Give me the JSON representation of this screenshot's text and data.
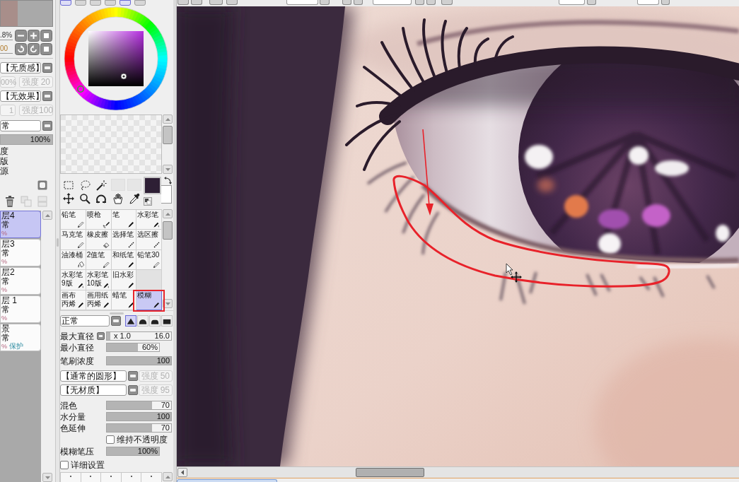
{
  "navigator": {
    "zoom": ".8%",
    "angle": "00"
  },
  "layer_settings": {
    "texture": "【无质感】",
    "texture_scale": {
      "value": "00%",
      "disabled": true
    },
    "texture_strength": {
      "label": "强度",
      "value": "20",
      "disabled": true
    },
    "effect": "【无效果】",
    "effect_width": {
      "value": "1",
      "disabled": true
    },
    "effect_strength": {
      "label": "强度",
      "value": "100",
      "disabled": true
    },
    "blend_mode": "常",
    "opacity": {
      "reading": "100%",
      "level": 1
    },
    "options": [
      "度",
      "版",
      "源"
    ]
  },
  "layers": [
    {
      "name": "层4",
      "mode": "常",
      "opacity": "%",
      "selected": true
    },
    {
      "name": "层3",
      "mode": "常",
      "opacity": "%",
      "selected": false
    },
    {
      "name": "层2",
      "mode": "常",
      "opacity": "%",
      "selected": false
    },
    {
      "name": "层 1",
      "mode": "常",
      "opacity": "%",
      "selected": false
    },
    {
      "name": "景",
      "mode": "常",
      "opacity": "%",
      "badge": "保护",
      "selected": false
    }
  ],
  "color_panel": {
    "modes": [
      {
        "on": true
      },
      {
        "on": false
      },
      {
        "on": false
      },
      {
        "on": false
      },
      {
        "on": true
      },
      {
        "on": false
      }
    ]
  },
  "brushes": [
    {
      "kind": "brush",
      "lines": [
        "铅笔"
      ],
      "selected": false,
      "highlighted": false
    },
    {
      "kind": "brush",
      "lines": [
        "喷枪"
      ],
      "selected": false,
      "highlighted": false
    },
    {
      "kind": "brush",
      "lines": [
        "笔"
      ],
      "selected": false,
      "highlighted": false
    },
    {
      "kind": "brush",
      "lines": [
        "水彩笔"
      ],
      "selected": false,
      "highlighted": false
    },
    {
      "kind": "brush",
      "lines": [
        "马克笔"
      ],
      "selected": false,
      "highlighted": false
    },
    {
      "kind": "brush",
      "lines": [
        "橡皮擦"
      ],
      "selected": false,
      "highlighted": false
    },
    {
      "kind": "brush",
      "lines": [
        "选择笔"
      ],
      "selected": false,
      "highlighted": false
    },
    {
      "kind": "brush",
      "lines": [
        "选区擦"
      ],
      "selected": false,
      "highlighted": false
    },
    {
      "kind": "brush",
      "lines": [
        "油漆桶"
      ],
      "selected": false,
      "highlighted": false
    },
    {
      "kind": "brush",
      "lines": [
        "2值笔"
      ],
      "selected": false,
      "highlighted": false
    },
    {
      "kind": "brush",
      "lines": [
        "和纸笔"
      ],
      "selected": false,
      "highlighted": false
    },
    {
      "kind": "brush",
      "lines": [
        "铅笔30"
      ],
      "selected": false,
      "highlighted": false
    },
    {
      "kind": "brush",
      "lines": [
        "水彩笔",
        "9版"
      ],
      "selected": false,
      "highlighted": false
    },
    {
      "kind": "brush",
      "lines": [
        "水彩笔",
        "10版"
      ],
      "selected": false,
      "highlighted": false
    },
    {
      "kind": "brush",
      "lines": [
        "旧水彩"
      ],
      "selected": false,
      "highlighted": false
    },
    {
      "kind": "empty"
    },
    {
      "kind": "brush",
      "lines": [
        "画布",
        "丙烯"
      ],
      "selected": false,
      "highlighted": false
    },
    {
      "kind": "brush",
      "lines": [
        "画用纸",
        "丙烯"
      ],
      "selected": false,
      "highlighted": false
    },
    {
      "kind": "brush",
      "lines": [
        "蜡笔"
      ],
      "selected": false,
      "highlighted": false
    },
    {
      "kind": "brush",
      "lines": [
        "模糊"
      ],
      "selected": true,
      "highlighted": true
    }
  ],
  "brush_settings": {
    "blend_mode": "正常",
    "tip_shapes": [
      {
        "selected": true
      },
      {
        "selected": false
      },
      {
        "selected": false
      },
      {
        "selected": false
      }
    ],
    "controls": [
      {
        "kind": "size_slider",
        "label": "最大直径",
        "scale": "x 1.0",
        "reading": "16.0",
        "level": 0.05
      },
      {
        "kind": "percent_slider",
        "label": "最小直径",
        "reading": "60%",
        "level": 0.6
      },
      {
        "kind": "slider",
        "label": "笔刷浓度",
        "reading": "100",
        "level": 1
      },
      {
        "kind": "dropdown",
        "value": "【通常的圆形】",
        "strength": {
          "label": "强度",
          "value": "50",
          "disabled": true
        }
      },
      {
        "kind": "dropdown",
        "value": "【无材质】",
        "strength": {
          "label": "强度",
          "value": "95",
          "disabled": true
        }
      },
      {
        "kind": "slider",
        "label": "混色",
        "reading": "70",
        "level": 0.7
      },
      {
        "kind": "slider",
        "label": "水分量",
        "reading": "100",
        "level": 1
      },
      {
        "kind": "slider",
        "label": "色延伸",
        "reading": "70",
        "level": 0.7
      },
      {
        "kind": "inline_checkbox",
        "label": "维持不透明度",
        "checked": false
      },
      {
        "kind": "percent_slider",
        "label": "模糊笔压",
        "reading": "100%",
        "level": 1
      },
      {
        "kind": "checkbox",
        "label": "详细设置",
        "checked": false
      }
    ]
  }
}
